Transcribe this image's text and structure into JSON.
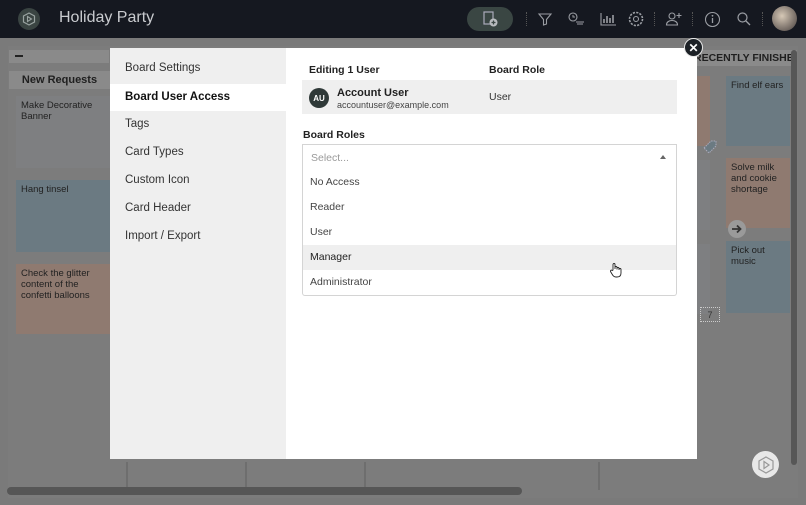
{
  "app": {
    "title": "Holiday Party"
  },
  "toolbar": {
    "icons": [
      "add-card-icon",
      "filter-icon",
      "timeline-icon",
      "chart-icon",
      "gear-icon",
      "add-user-icon",
      "info-icon",
      "search-icon",
      "user-avatar"
    ]
  },
  "board": {
    "left_column": {
      "header": "New Requests",
      "cards": [
        {
          "text": "Make Decorative Banner",
          "color": "#7e7f81"
        },
        {
          "text": "Hang tinsel",
          "color": "#6b7a82"
        },
        {
          "text": "Check the glitter content of the confetti balloons",
          "color": "#8f7a70"
        }
      ]
    },
    "right_column": {
      "header": "RECENTLY FINISHED",
      "cards": [
        {
          "text": "Find elf ears",
          "color": "#6b7a82"
        },
        {
          "text": "Solve milk and cookie shortage",
          "color": "#8f7a70"
        },
        {
          "text": "Pick out music",
          "color": "#6b7a82"
        }
      ],
      "badge_count": "7"
    }
  },
  "modal": {
    "sidebar": {
      "items": [
        {
          "label": "Board Settings",
          "active": false
        },
        {
          "label": "Board User Access",
          "active": true
        },
        {
          "label": "Tags",
          "active": false
        },
        {
          "label": "Card Types",
          "active": false
        },
        {
          "label": "Custom Icon",
          "active": false
        },
        {
          "label": "Card Header",
          "active": false
        },
        {
          "label": "Import / Export",
          "active": false
        }
      ]
    },
    "table": {
      "col_user": "Editing 1 User",
      "col_role": "Board Role",
      "user": {
        "initials": "AU",
        "name": "Account User",
        "email": "accountuser@example.com",
        "role": "User"
      }
    },
    "roles": {
      "label": "Board Roles",
      "placeholder": "Select...",
      "options": [
        "No Access",
        "Reader",
        "User",
        "Manager",
        "Administrator"
      ],
      "hovered": "Manager"
    }
  }
}
